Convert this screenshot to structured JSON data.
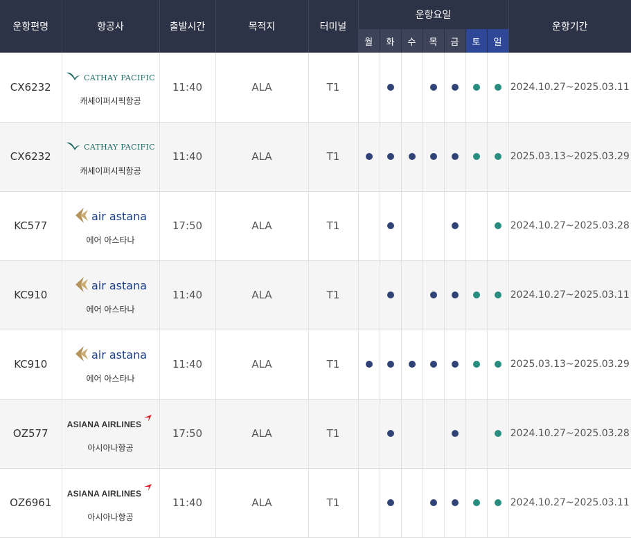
{
  "headers": {
    "flight": "운항편명",
    "airline": "항공사",
    "departure": "출발시간",
    "destination": "목적지",
    "terminal": "터미널",
    "days": "운항요일",
    "period": "운항기간"
  },
  "days": [
    "월",
    "화",
    "수",
    "목",
    "금",
    "토",
    "일"
  ],
  "colors": {
    "header_bg": "#2c3346",
    "weekday_dot": "#2f4377",
    "weekend_dot": "#288c7e",
    "weekend_header": "#2e4797"
  },
  "rows": [
    {
      "flight": "CX6232",
      "logo": "cathay-pacific-logo",
      "logo_text": "CATHAY PACIFIC",
      "airline": "캐세이퍼시픽항공",
      "time": "11:40",
      "dest": "ALA",
      "terminal": "T1",
      "days": [
        0,
        1,
        0,
        1,
        1,
        1,
        1
      ],
      "period": "2024.10.27~2025.03.11"
    },
    {
      "flight": "CX6232",
      "logo": "cathay-pacific-logo",
      "logo_text": "CATHAY PACIFIC",
      "airline": "캐세이퍼시픽항공",
      "time": "11:40",
      "dest": "ALA",
      "terminal": "T1",
      "days": [
        1,
        1,
        1,
        1,
        1,
        1,
        1
      ],
      "period": "2025.03.13~2025.03.29"
    },
    {
      "flight": "KC577",
      "logo": "air-astana-logo",
      "logo_text": "air astana",
      "airline": "에어 아스타나",
      "time": "17:50",
      "dest": "ALA",
      "terminal": "T1",
      "days": [
        0,
        1,
        0,
        0,
        1,
        0,
        1
      ],
      "period": "2024.10.27~2025.03.28"
    },
    {
      "flight": "KC910",
      "logo": "air-astana-logo",
      "logo_text": "air astana",
      "airline": "에어 아스타나",
      "time": "11:40",
      "dest": "ALA",
      "terminal": "T1",
      "days": [
        0,
        1,
        0,
        1,
        1,
        1,
        1
      ],
      "period": "2024.10.27~2025.03.11"
    },
    {
      "flight": "KC910",
      "logo": "air-astana-logo",
      "logo_text": "air astana",
      "airline": "에어 아스타나",
      "time": "11:40",
      "dest": "ALA",
      "terminal": "T1",
      "days": [
        1,
        1,
        1,
        1,
        1,
        1,
        1
      ],
      "period": "2025.03.13~2025.03.29"
    },
    {
      "flight": "OZ577",
      "logo": "asiana-airlines-logo",
      "logo_text": "ASIANA AIRLINES",
      "airline": "아시아나항공",
      "time": "17:50",
      "dest": "ALA",
      "terminal": "T1",
      "days": [
        0,
        1,
        0,
        0,
        1,
        0,
        1
      ],
      "period": "2024.10.27~2025.03.28"
    },
    {
      "flight": "OZ6961",
      "logo": "asiana-airlines-logo",
      "logo_text": "ASIANA AIRLINES",
      "airline": "아시아나항공",
      "time": "11:40",
      "dest": "ALA",
      "terminal": "T1",
      "days": [
        0,
        1,
        0,
        1,
        1,
        1,
        1
      ],
      "period": "2024.10.27~2025.03.11"
    }
  ]
}
